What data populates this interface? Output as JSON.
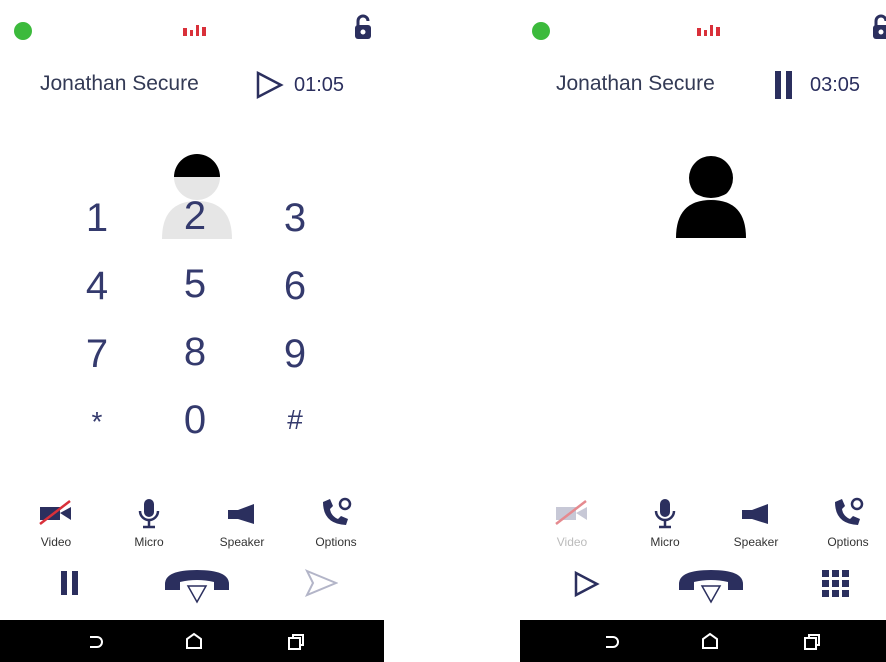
{
  "left": {
    "caller_name": "Jonathan Secure",
    "timer": "01:05",
    "keypad": [
      "1",
      "2",
      "3",
      "4",
      "5",
      "6",
      "7",
      "8",
      "9",
      "*",
      "0",
      "#"
    ],
    "tools": {
      "video": "Video",
      "micro": "Micro",
      "speaker": "Speaker",
      "options": "Options"
    }
  },
  "right": {
    "caller_name": "Jonathan Secure",
    "timer": "03:05",
    "tools": {
      "video": "Video",
      "micro": "Micro",
      "speaker": "Speaker",
      "options": "Options"
    }
  },
  "colors": {
    "accent": "#2b2f5e",
    "status_green": "#3cba3c",
    "signal_red": "#d9303a",
    "muted": "#bbbbbb",
    "navbar": "#000000"
  },
  "icons": [
    "status-dot-icon",
    "signal-icon",
    "lock-icon",
    "play-icon",
    "pause-icon",
    "avatar-icon",
    "video-off-icon",
    "mic-icon",
    "speaker-icon",
    "call-options-icon",
    "hangup-icon",
    "send-icon",
    "keypad-icon",
    "back-icon",
    "home-icon",
    "recents-icon"
  ]
}
